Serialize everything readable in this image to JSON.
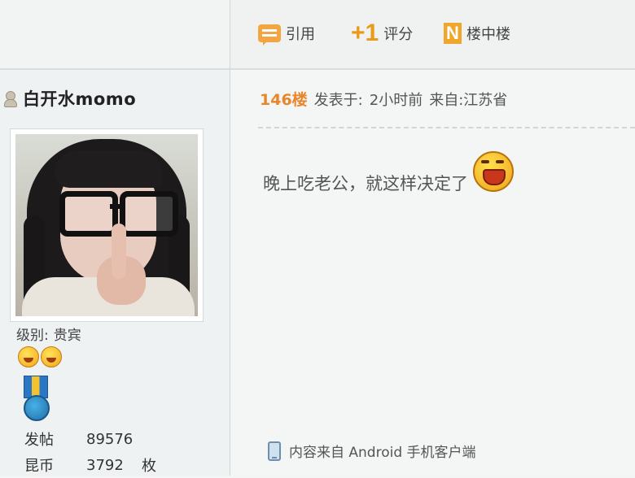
{
  "user": {
    "name": "白开水momo",
    "level_label": "级别:",
    "level_value": "贵宾",
    "stats": [
      {
        "label": "发帖",
        "value": "89576",
        "unit": ""
      },
      {
        "label": "昆币",
        "value": "3792",
        "unit": "枚"
      }
    ]
  },
  "toolbar": {
    "quote_label": "引用",
    "rate_icon_text": "+1",
    "rate_label": "评分",
    "floor_icon_text": "N",
    "floor_label": "楼中楼"
  },
  "post": {
    "floor": "146楼",
    "posted_prefix": "发表于:",
    "posted_time": "2小时前",
    "location": "来自:江苏省",
    "body": "晚上吃老公，就这样决定了",
    "footer": "内容来自 Android 手机客户端"
  },
  "colors": {
    "accent_orange": "#e8862a",
    "background": "#f4f5f5"
  },
  "icons": [
    "user-icon",
    "quote-icon",
    "plus-one-icon",
    "floor-icon",
    "laugh-emoticon-icon",
    "medal-icon",
    "phone-icon"
  ]
}
